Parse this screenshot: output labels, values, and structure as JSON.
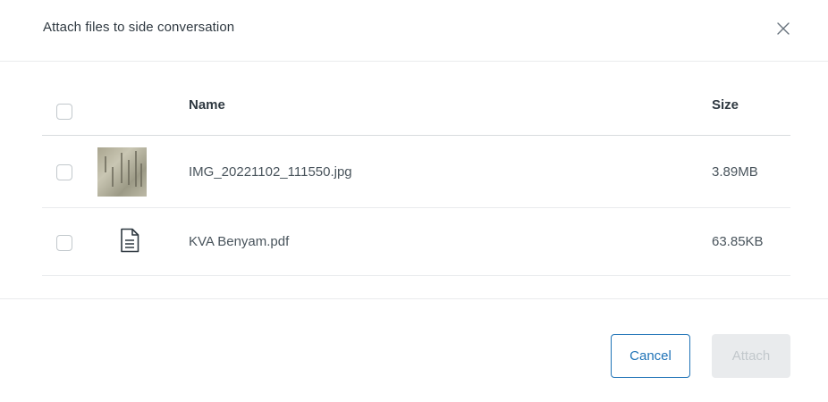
{
  "dialog": {
    "title": "Attach files to side conversation",
    "close_icon": "close-icon"
  },
  "table": {
    "columns": {
      "name": "Name",
      "size": "Size"
    },
    "files": [
      {
        "name": "IMG_20221102_111550.jpg",
        "size": "3.89MB",
        "icon": "image-thumbnail",
        "checked": false
      },
      {
        "name": "KVA Benyam.pdf",
        "size": "63.85KB",
        "icon": "document-icon",
        "checked": false
      }
    ]
  },
  "footer": {
    "cancel_label": "Cancel",
    "attach_label": "Attach",
    "attach_disabled": true
  },
  "colors": {
    "accent": "#1f73b7",
    "border": "#e9ebed",
    "disabled_bg": "#e9ebed",
    "disabled_text": "#c2c8cc",
    "text": "#2f3941"
  }
}
